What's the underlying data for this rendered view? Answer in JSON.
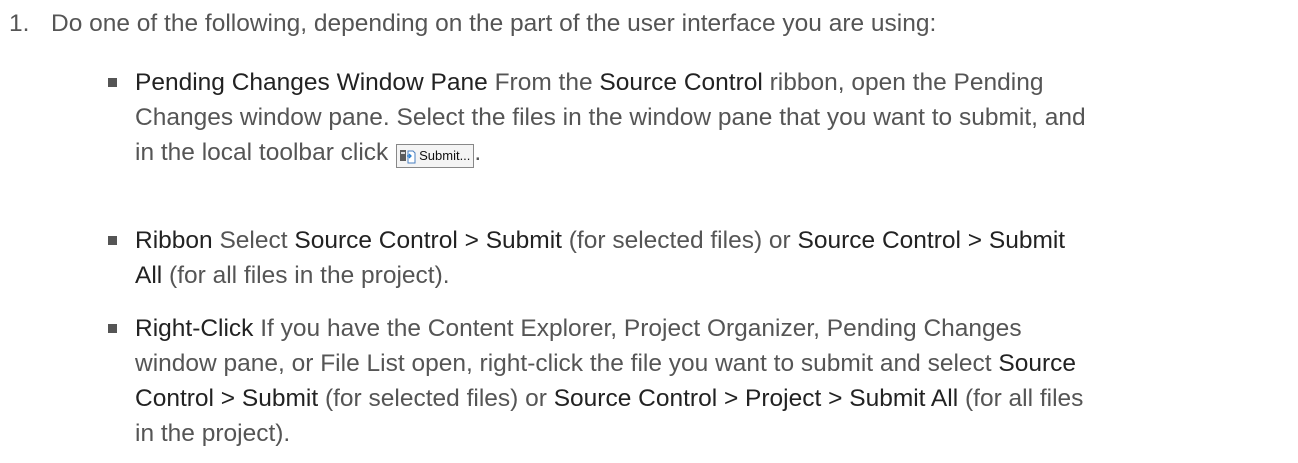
{
  "step": {
    "number": "1.",
    "text": "Do one of the following, depending on the part of the user interface you are using:"
  },
  "bullets": [
    {
      "term": "Pending Changes Window Pane",
      "l1_a": " From the ",
      "l1_b": "Source Control",
      "l1_c": " ribbon, open the Pending",
      "l2": "Changes window pane. Select the files in the window pane that you want to submit, and",
      "l3_a": "in the local toolbar click ",
      "button_icon": "submit-icon",
      "button_label": "Submit...",
      "l3_end": "."
    },
    {
      "term": "Ribbon",
      "l1_a": " Select ",
      "l1_b": "Source Control > Submit",
      "l1_c": " (for selected files) or ",
      "l1_d": "Source Control > Submit",
      "l2_a": "All",
      "l2_b": " (for all files in the project)."
    },
    {
      "term": "Right-Click",
      "l1_a": " If you have the Content Explorer, Project Organizer, Pending Changes",
      "l2_a": "window pane, or File List open, right-click the file you want to submit and select ",
      "l2_b": "Source",
      "l3_a": "Control > Submit",
      "l3_b": " (for selected files) or ",
      "l3_c": "Source Control > Project > Submit All",
      "l3_d": " (for all files",
      "l4": "in the project)."
    }
  ]
}
